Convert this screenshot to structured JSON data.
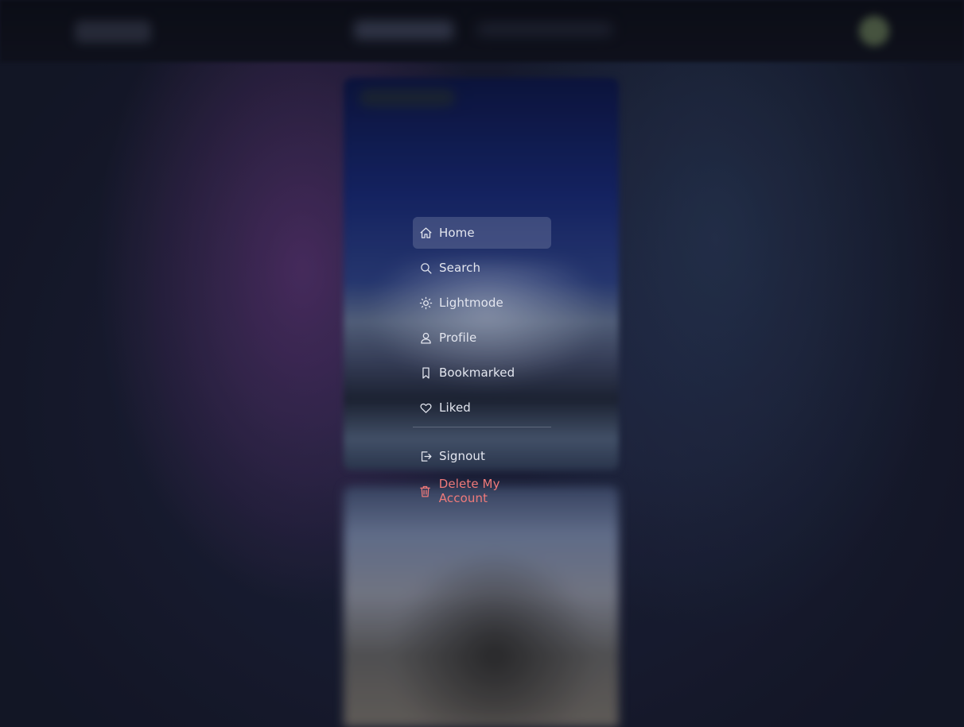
{
  "menu": {
    "items": [
      {
        "label": "Home",
        "icon": "home-icon",
        "active": true
      },
      {
        "label": "Search",
        "icon": "search-icon"
      },
      {
        "label": "Lightmode",
        "icon": "sun-icon"
      },
      {
        "label": "Profile",
        "icon": "user-icon"
      },
      {
        "label": "Bookmarked",
        "icon": "bookmark-icon"
      },
      {
        "label": "Liked",
        "icon": "heart-icon"
      }
    ],
    "signout": {
      "label": "Signout",
      "icon": "signout-icon"
    },
    "delete_account": {
      "label": "Delete My Account",
      "icon": "trash-icon",
      "color": "#f07a7a"
    }
  },
  "colors": {
    "background": "#151a29",
    "menu_text": "#e3e6ef",
    "active_highlight": "#5a6280",
    "danger": "#f07a7a"
  }
}
